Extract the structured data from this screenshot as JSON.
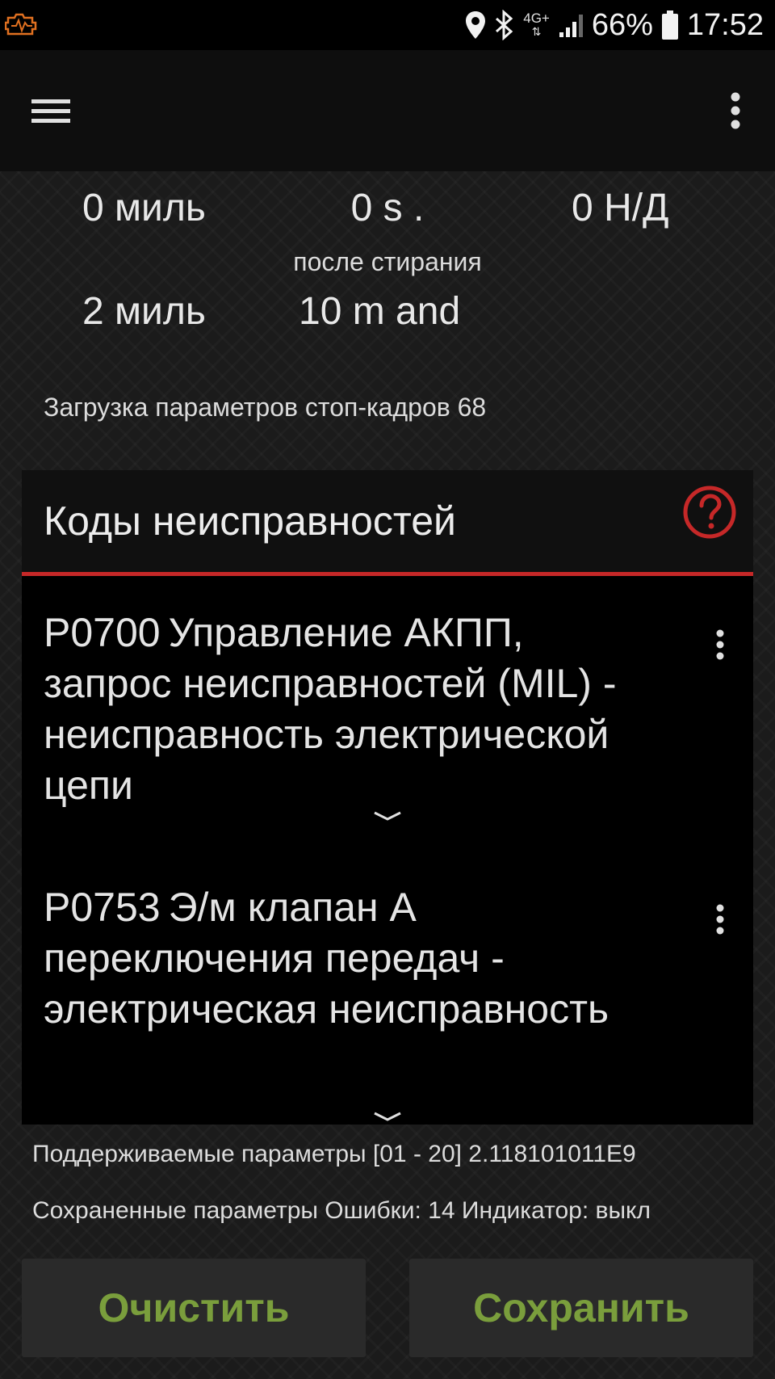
{
  "status_bar": {
    "network": "4G+",
    "battery": "66%",
    "time": "17:52",
    "icons": [
      "app-obd-icon",
      "location-icon",
      "bluetooth-icon",
      "network-arrows-icon",
      "signal-icon",
      "battery-icon"
    ]
  },
  "app_bar": {
    "icons": [
      "menu-icon",
      "more-vert-icon"
    ]
  },
  "stats": {
    "row1": {
      "left": "0 миль",
      "center": "0 s .",
      "right": "0 Н/Д"
    },
    "caption": "после стирания",
    "row2": {
      "left": "2 миль",
      "center": "10 m and"
    }
  },
  "freeze_frame": "Загрузка параметров стоп-кадров 68",
  "dtc": {
    "title": "Коды неисправностей",
    "accent": "#c62828",
    "items": [
      {
        "code": "P0700",
        "description": "Управление АКПП, запрос неисправностей (MIL) - неисправность электрической цепи"
      },
      {
        "code": "P0753",
        "description": "Э/м клапан A переключения передач - электрическая неисправность"
      }
    ]
  },
  "info": {
    "supported": "Поддерживаемые параметры [01 - 20] 2.118101011E9",
    "saved": "Сохраненные параметры Ошибки: 14 Индикатор: выкл"
  },
  "buttons": {
    "clear": "Очистить",
    "save": "Сохранить",
    "text_color": "#7a9e3c"
  }
}
